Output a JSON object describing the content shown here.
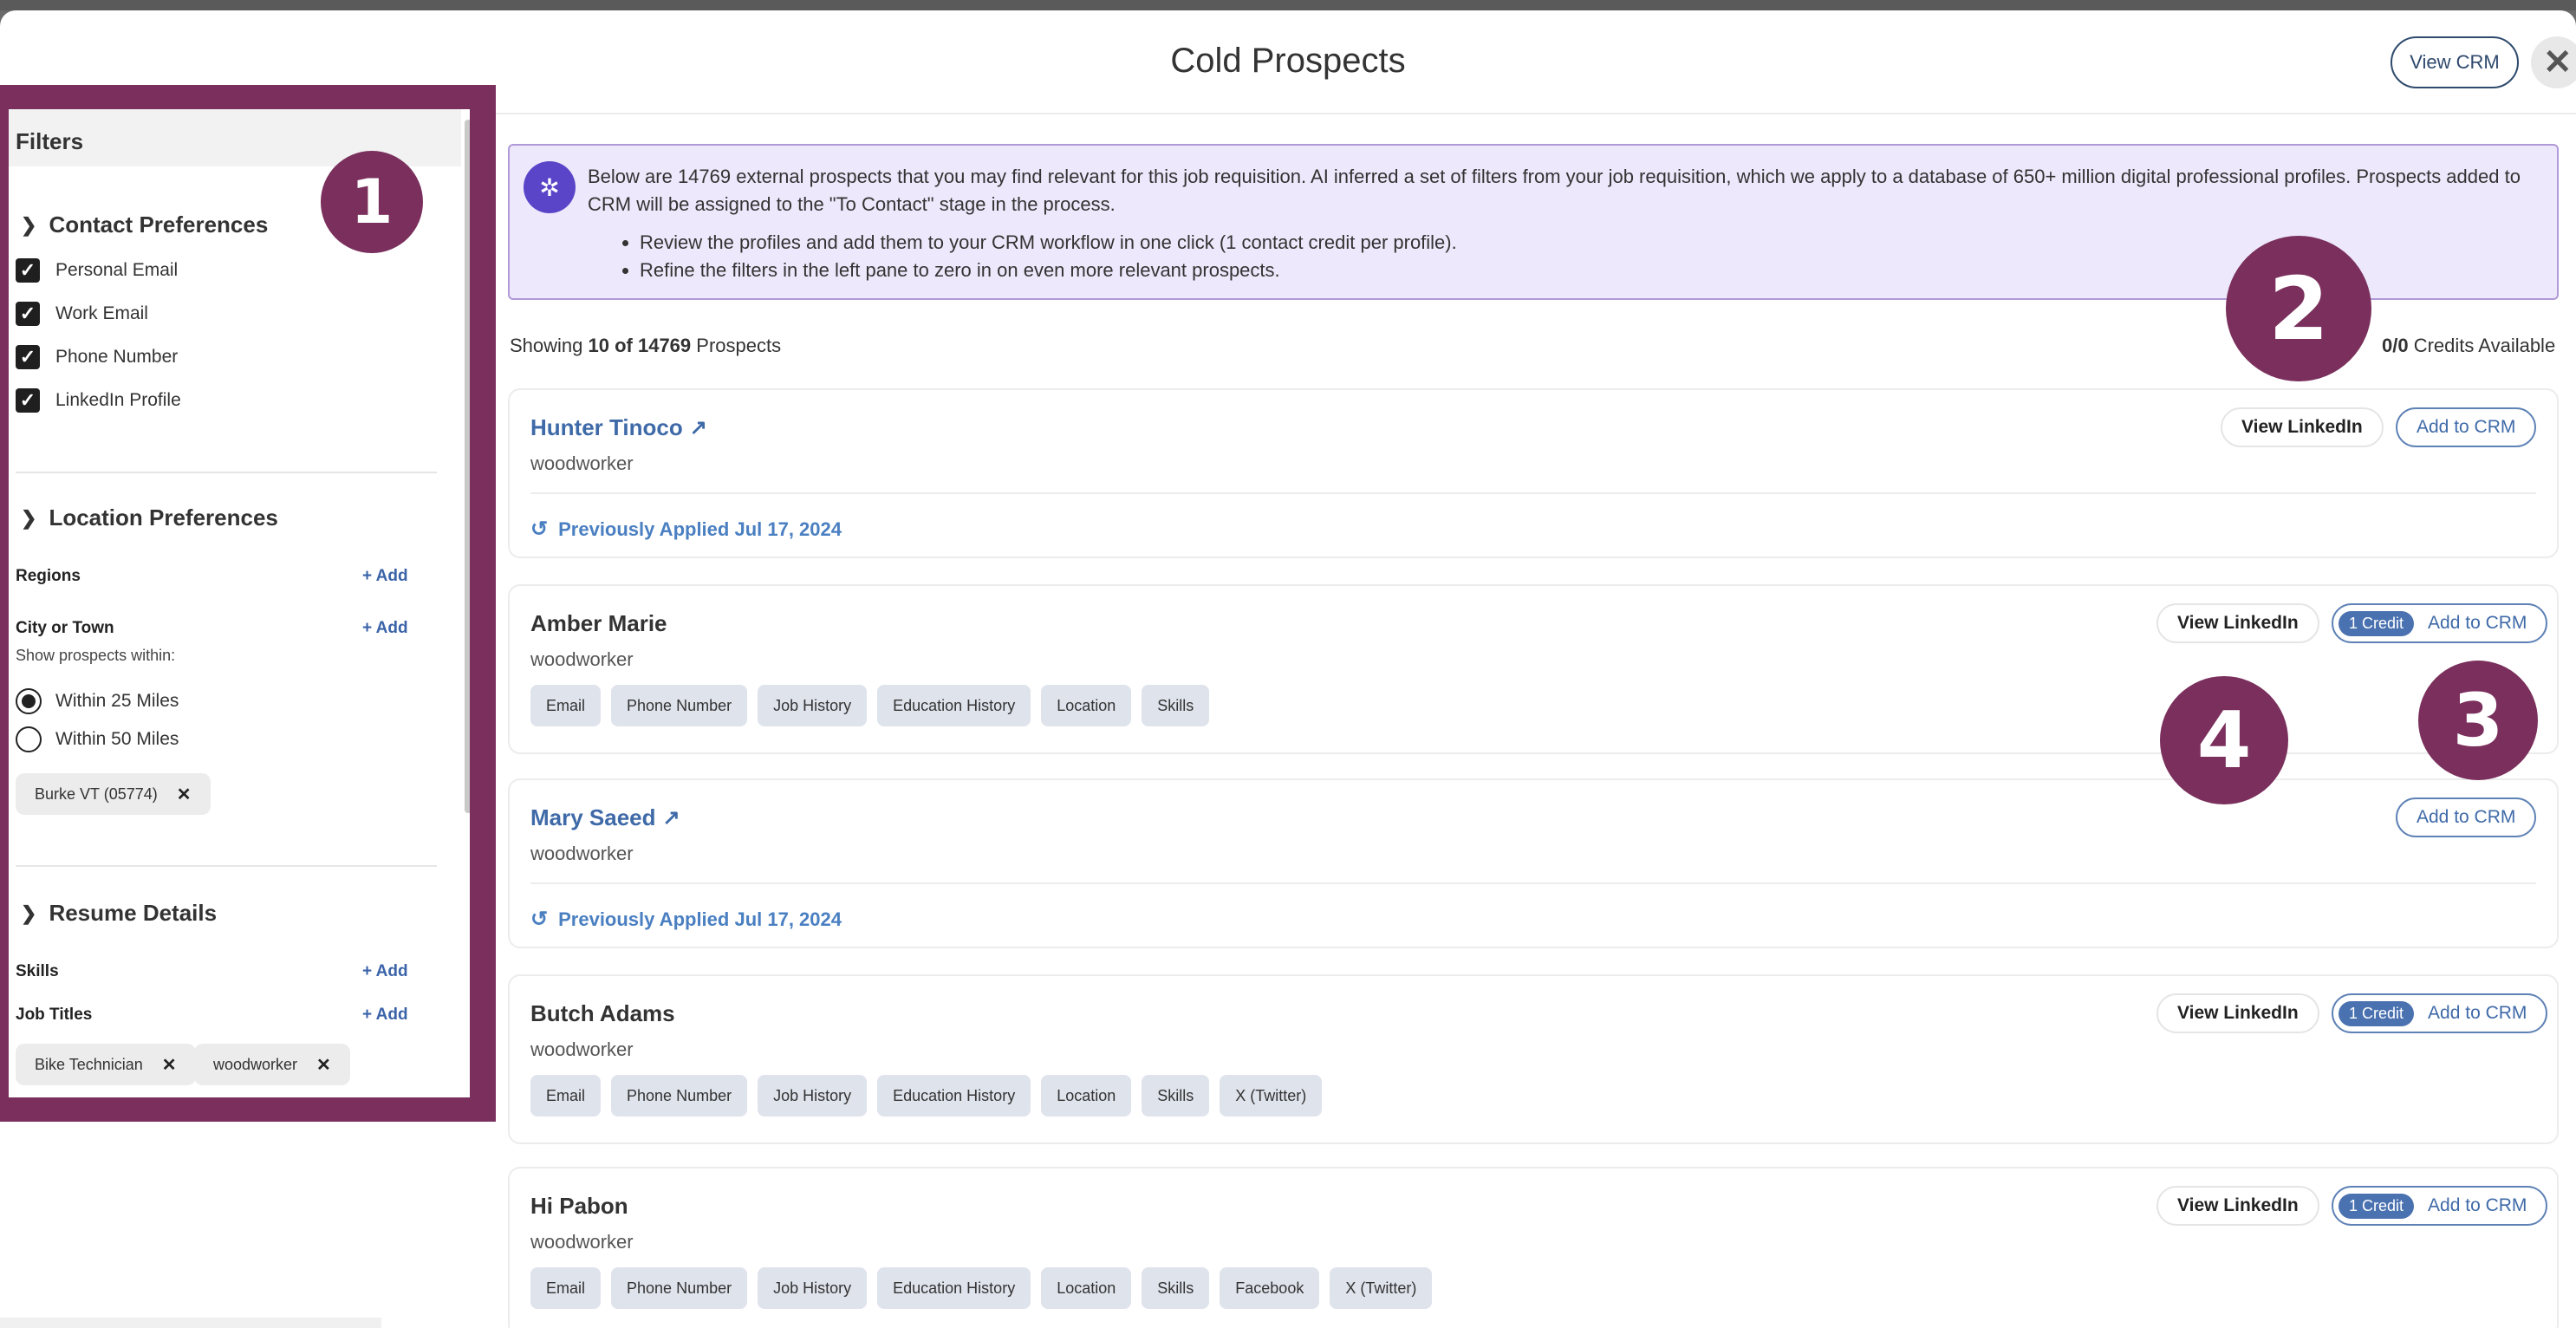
{
  "modal": {
    "title": "Cold Prospects",
    "view_crm_label": "View CRM",
    "close_glyph": "✕"
  },
  "sidebar": {
    "header": "Filters",
    "contact": {
      "title": "Contact Preferences",
      "options": [
        "Personal Email",
        "Work Email",
        "Phone Number",
        "LinkedIn Profile"
      ],
      "checked": [
        true,
        true,
        true,
        true
      ]
    },
    "location": {
      "title": "Location Preferences",
      "regions_label": "Regions",
      "city_label": "City or Town",
      "add_label": "+ Add",
      "within_label": "Show prospects within:",
      "radius_options": [
        "Within 25 Miles",
        "Within 50 Miles"
      ],
      "radius_selected": "Within 25 Miles",
      "city_chip": "Burke VT (05774)"
    },
    "resume": {
      "title": "Resume Details",
      "skills_label": "Skills",
      "job_titles_label": "Job Titles",
      "add_label": "+ Add",
      "job_title_chips": [
        "Bike Technician",
        "woodworker"
      ]
    }
  },
  "banner": {
    "text": "Below are 14769 external prospects that you may find relevant for this job requisition. AI inferred a set of filters from your job requisition, which we apply to a database of 650+ million digital professional profiles. Prospects added to CRM will be assigned to the \"To Contact\" stage in the process.",
    "bullets": [
      "Review the profiles and add them to your CRM workflow in one click (1 contact credit per profile).",
      "Refine the filters in the left pane to zero in on even more relevant prospects."
    ]
  },
  "summary": {
    "showing_prefix": "Showing",
    "showing_count": "10 of 14769",
    "showing_suffix": "Prospects",
    "credits_value": "0/0",
    "credits_suffix": "Credits Available"
  },
  "buttons": {
    "view_linkedin": "View LinkedIn",
    "add_to_crm": "Add to CRM",
    "credit_pill": "1 Credit"
  },
  "prospects": [
    {
      "name": "Hunter Tinoco",
      "title": "woodworker",
      "applied": "Previously Applied Jul 17, 2024"
    },
    {
      "name": "Amber Marie",
      "title": "woodworker",
      "tags": [
        "Email",
        "Phone Number",
        "Job History",
        "Education History",
        "Location",
        "Skills"
      ]
    },
    {
      "name": "Mary Saeed",
      "title": "woodworker",
      "applied": "Previously Applied Jul 17, 2024"
    },
    {
      "name": "Butch Adams",
      "title": "woodworker",
      "tags": [
        "Email",
        "Phone Number",
        "Job History",
        "Education History",
        "Location",
        "Skills",
        "X (Twitter)"
      ]
    },
    {
      "name": "Hi Pabon",
      "title": "woodworker",
      "tags": [
        "Email",
        "Phone Number",
        "Job History",
        "Education History",
        "Location",
        "Skills",
        "Facebook",
        "X (Twitter)"
      ]
    }
  ],
  "callouts": [
    "1",
    "2",
    "3",
    "4"
  ],
  "colors": {
    "callout": "#7a2f5c",
    "link": "#3f6aa8",
    "banner_bg": "#ede8fb",
    "tag_bg": "#dfe3ec"
  }
}
